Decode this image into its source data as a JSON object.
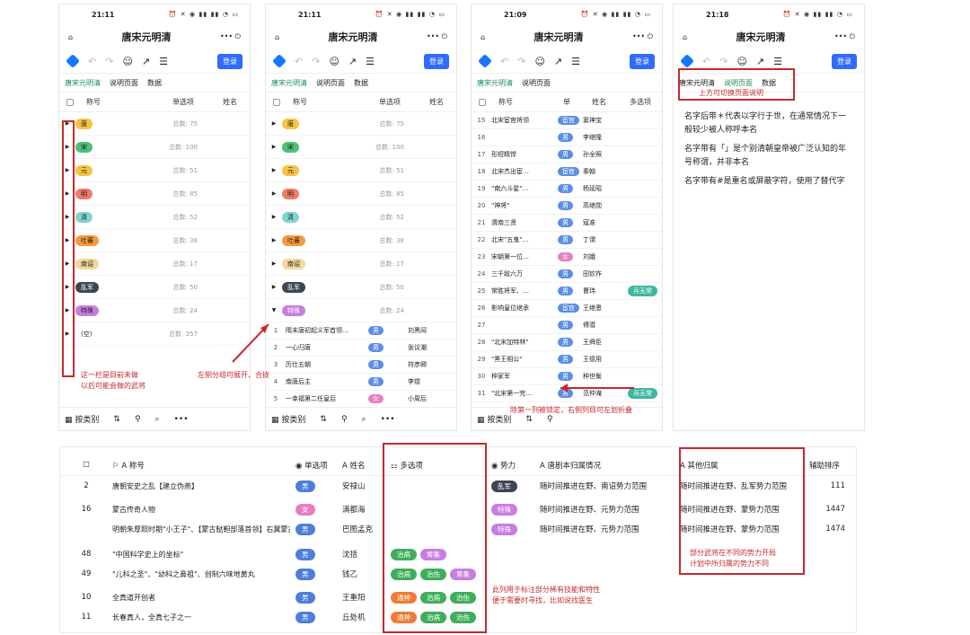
{
  "phone1": {
    "time": "21:11",
    "battery": "84",
    "title": "唐宋元明清",
    "login": "登录",
    "tabs": [
      "唐宋元明清",
      "说明页面",
      "数据"
    ],
    "headers": [
      "称号",
      "单选项",
      "姓名"
    ],
    "groups": [
      {
        "label": "唐",
        "color": "#f6c342",
        "count": "总数: 75"
      },
      {
        "label": "宋",
        "color": "#4fc07a",
        "count": "总数: 100"
      },
      {
        "label": "元",
        "color": "#f6c342",
        "count": "总数: 51"
      },
      {
        "label": "明",
        "color": "#f07b6b",
        "count": "总数: 85"
      },
      {
        "label": "清",
        "color": "#7fd6cf",
        "count": "总数: 52"
      },
      {
        "label": "吐蕃",
        "color": "#f59a3e",
        "count": "总数: 38"
      },
      {
        "label": "南诏",
        "color": "#f4d79b",
        "count": "总数: 17"
      },
      {
        "label": "乱军",
        "color": "#3c4555",
        "count": "总数: 50"
      },
      {
        "label": "特殊",
        "color": "#c77ee0",
        "count": "总数: 24"
      },
      {
        "label": "(空)",
        "color": "transparent",
        "count": "总数: 357"
      }
    ],
    "bottom": [
      "按类别"
    ],
    "note": "这一栏是目前未做\n以后可能会做的武将"
  },
  "phone2": {
    "time": "21:11",
    "battery": "84",
    "title": "唐宋元明清",
    "login": "登录",
    "tabs": [
      "唐宋元明清",
      "说明页面",
      "数据"
    ],
    "headers": [
      "称号",
      "单选项",
      "姓名"
    ],
    "groups": [
      {
        "label": "唐",
        "color": "#f6c342",
        "count": "总数: 75"
      },
      {
        "label": "宋",
        "color": "#4fc07a",
        "count": "总数: 100"
      },
      {
        "label": "元",
        "color": "#f6c342",
        "count": "总数: 51"
      },
      {
        "label": "明",
        "color": "#f07b6b",
        "count": "总数: 85"
      },
      {
        "label": "清",
        "color": "#7fd6cf",
        "count": "总数: 52"
      },
      {
        "label": "吐蕃",
        "color": "#f59a3e",
        "count": "总数: 38"
      },
      {
        "label": "南诏",
        "color": "#f4d79b",
        "count": "总数: 17"
      },
      {
        "label": "乱军",
        "color": "#3c4555",
        "count": "总数: 50"
      },
      {
        "label": "特殊",
        "color": "#c77ee0",
        "count": "总数: 24"
      }
    ],
    "rows": [
      {
        "n": "1",
        "name": "隋末唐初起义军首领…",
        "tag": "男",
        "person": "刘黑闼"
      },
      {
        "n": "2",
        "name": "一心归唐",
        "tag": "男",
        "person": "张议潮"
      },
      {
        "n": "3",
        "name": "历仕五朝",
        "tag": "男",
        "person": "符彦卿"
      },
      {
        "n": "4",
        "name": "南唐后主",
        "tag": "男",
        "person": "李煜"
      },
      {
        "n": "5",
        "name": "一幸福第二任皇后",
        "tag": "女",
        "person": "小周后"
      }
    ],
    "note": "左侧分组可展开、合拢",
    "bottom": [
      "按类别"
    ]
  },
  "phone3": {
    "time": "21:09",
    "battery": "85",
    "title": "唐宋元明清",
    "login": "登录",
    "tabs": [
      "唐宋元明清",
      "说明页面"
    ],
    "headers": [
      "称号",
      "单",
      "姓名",
      "多选项"
    ],
    "rows": [
      {
        "n": "15",
        "name": "北宋宦官将领",
        "tag": "宦官",
        "person": "窦神宝",
        "extra": ""
      },
      {
        "n": "16",
        "name": "",
        "tag": "男",
        "person": "李继隆",
        "extra": ""
      },
      {
        "n": "17",
        "name": "形短精悍",
        "tag": "男",
        "person": "孙全照",
        "extra": ""
      },
      {
        "n": "18",
        "name": "北宋杰出宦…",
        "tag": "宦官",
        "person": "秦翰",
        "extra": ""
      },
      {
        "n": "19",
        "name": "\"南六斗星\"…",
        "tag": "男",
        "person": "杨延昭",
        "extra": ""
      },
      {
        "n": "20",
        "name": "\"神将\"",
        "tag": "男",
        "person": "高继勋",
        "extra": ""
      },
      {
        "n": "21",
        "name": "渭南三贤",
        "tag": "男",
        "person": "寇准",
        "extra": ""
      },
      {
        "n": "22",
        "name": "北宋\"五鬼\"…",
        "tag": "男",
        "person": "丁谓",
        "extra": ""
      },
      {
        "n": "23",
        "name": "宋朝第一位…",
        "tag": "女",
        "person": "刘娥",
        "extra": ""
      },
      {
        "n": "24",
        "name": "三千敌六万",
        "tag": "男",
        "person": "田钦祚",
        "extra": ""
      },
      {
        "n": "25",
        "name": "常胜将军、…",
        "tag": "男",
        "person": "曹玮",
        "extra": "兵无常"
      },
      {
        "n": "26",
        "name": "影响皇位继承",
        "tag": "宦官",
        "person": "王继恩",
        "extra": ""
      },
      {
        "n": "27",
        "name": "",
        "tag": "男",
        "person": "傅潜",
        "extra": ""
      },
      {
        "n": "28",
        "name": "\"北宋加特林\"",
        "tag": "男",
        "person": "王舜臣",
        "extra": ""
      },
      {
        "n": "29",
        "name": "\"黑王相公\"",
        "tag": "男",
        "person": "王德用",
        "extra": ""
      },
      {
        "n": "30",
        "name": "种家军",
        "tag": "男",
        "person": "种世衡",
        "extra": ""
      },
      {
        "n": "31",
        "name": "\"北宋第一完…",
        "tag": "男",
        "person": "范仲淹",
        "extra": "兵无常"
      }
    ],
    "note": "除第一列被锁定，右侧列目可左划折叠",
    "bottom": [
      "按类别"
    ]
  },
  "phone4": {
    "time": "21:18",
    "battery": "82",
    "title": "唐宋元明清",
    "login": "登录",
    "tabs": [
      "唐宋元明清",
      "说明页面",
      "数据"
    ],
    "annot": "上方可切换页面说明",
    "lines": [
      "名字后带＊代表以字行于世，在通常情况下一般较少被人称呼本名",
      "名字带有「」是个别清朝皇帝被广泛认知的年号称谓，并非本名",
      "名字带有#是重名或屏蔽字符，使用了替代字"
    ]
  },
  "table": {
    "headers": [
      "称号",
      "单选项",
      "姓名",
      "多选项",
      "势力",
      "唐剧本归属情况",
      "其他归属",
      "辅助排序"
    ],
    "rows": [
      {
        "n": "2",
        "title": "唐朝安史之乱【建立伪燕】",
        "sel": "男",
        "selc": "bl",
        "name": "安禄山",
        "multi": [],
        "force": "乱军",
        "forcec": "dk",
        "tang": "随时间推进在野、南诏势力范围",
        "other": "随时间推进在野、乱军势力范围",
        "sort": "111"
      },
      {
        "n": "16",
        "title": "蒙古传奇人物",
        "sel": "女",
        "selc": "pk",
        "name": "满都海",
        "multi": [],
        "force": "特殊",
        "forcec": "p",
        "tang": "随时间推进在野、元势力范围",
        "other": "随时间推进在野、蒙势力范围",
        "sort": "1447"
      },
      {
        "n": "",
        "title": "明朝朱厚照时期\"小王子\"、【蒙古鞑靼部落首领】右翼蒙古的 \"中兴之主\"",
        "sel": "男",
        "selc": "bl",
        "name": "巴图孟克",
        "multi": [],
        "force": "特殊",
        "forcec": "p",
        "tang": "随时间推进在野、元势力范围",
        "other": "随时间推进在野、蒙势力范围",
        "sort": "1474"
      },
      {
        "n": "48",
        "title": "\"中国科学史上的坐标\"",
        "sel": "男",
        "selc": "bl",
        "name": "沈括",
        "multi": [
          {
            "t": "治病",
            "c": "g"
          },
          {
            "t": "筹集",
            "c": "p"
          }
        ],
        "force": "",
        "tang": "",
        "other": "",
        "sort": ""
      },
      {
        "n": "49",
        "title": "\"儿科之圣\"、\"幼科之鼻祖\"、创制六味地黄丸",
        "sel": "男",
        "selc": "bl",
        "name": "钱乙",
        "multi": [
          {
            "t": "治病",
            "c": "g"
          },
          {
            "t": "治伤",
            "c": "g"
          },
          {
            "t": "筹集",
            "c": "p"
          }
        ],
        "force": "",
        "tang": "",
        "other": "",
        "sort": ""
      },
      {
        "n": "10",
        "title": "全真道开创者",
        "sel": "男",
        "selc": "bl",
        "name": "王重阳",
        "multi": [
          {
            "t": "通神",
            "c": "o"
          },
          {
            "t": "治病",
            "c": "g"
          },
          {
            "t": "治伤",
            "c": "g"
          }
        ],
        "force": "",
        "tang": "",
        "other": "",
        "sort": ""
      },
      {
        "n": "11",
        "title": "长春真人，全真七子之一",
        "sel": "男",
        "selc": "bl",
        "name": "丘处机",
        "multi": [
          {
            "t": "通神",
            "c": "o"
          },
          {
            "t": "治病",
            "c": "g"
          },
          {
            "t": "治伤",
            "c": "g"
          }
        ],
        "force": "",
        "tang": "",
        "other": "",
        "sort": ""
      }
    ],
    "note_multi": "此列用于标注部分稀有技能和特性\n便于需要时寻找，比如说找医生",
    "note_other": "部分武将在不同的势力开局\n计划中所归属的势力不同"
  }
}
